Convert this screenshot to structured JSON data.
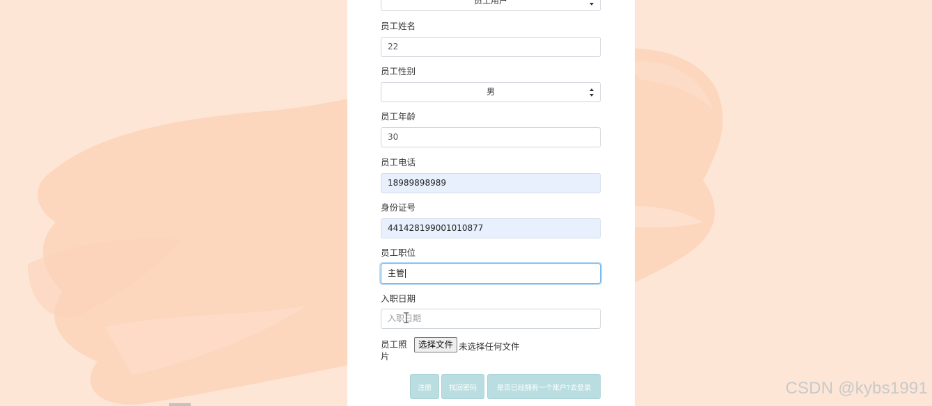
{
  "form": {
    "user_type_value": "员工用户",
    "name_label": "员工姓名",
    "name_value": "22",
    "gender_label": "员工性别",
    "gender_value": "男",
    "age_label": "员工年龄",
    "age_value": "30",
    "phone_label": "员工电话",
    "phone_value": "18989898989",
    "id_label": "身份证号",
    "id_value": "441428199001010877",
    "position_label": "员工职位",
    "position_value": "主管",
    "hire_date_label": "入职日期",
    "hire_date_placeholder": "入职日期",
    "photo_label": "员工照片",
    "photo_button": "选择文件",
    "photo_status": "未选择任何文件"
  },
  "actions": {
    "register": "注册",
    "forgot_password": "找回密码",
    "have_account": "是否已经拥有一个账户?去登录"
  },
  "watermark": "CSDN @kybs1991",
  "colors": {
    "background": "#fde6d6",
    "brush": "#fbd2b9",
    "button": "#b9dde0",
    "autofill": "#e8f0fe",
    "focus": "#66afe9"
  }
}
